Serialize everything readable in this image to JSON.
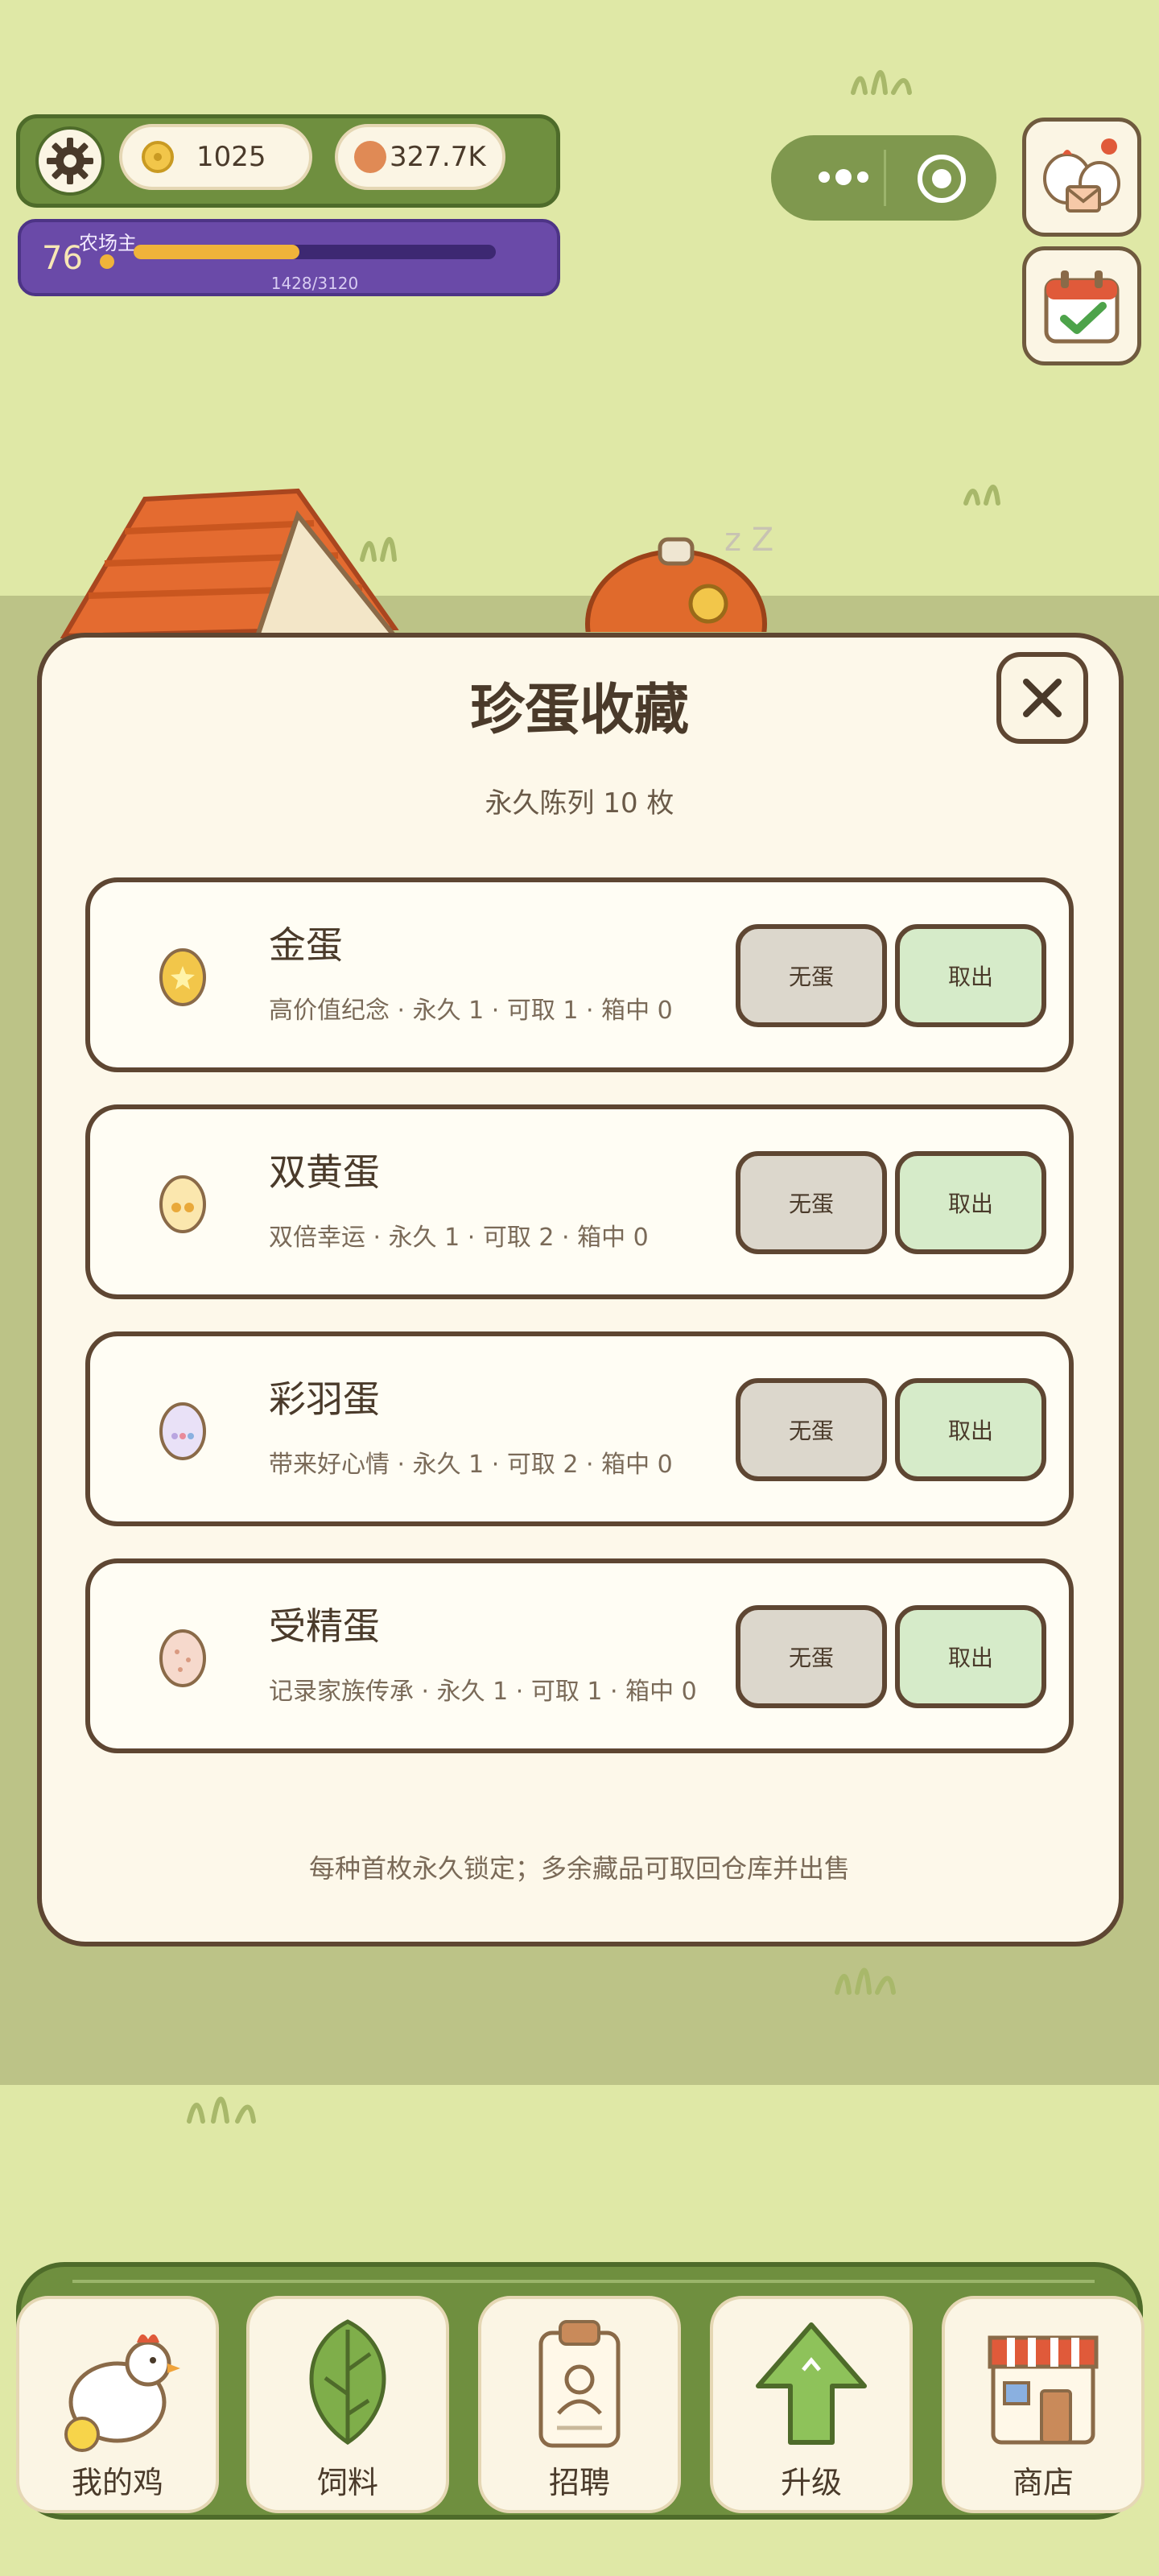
{
  "hud": {
    "coins": "1025",
    "copper": "327.7K",
    "level": "76",
    "level_title": "农场主",
    "xp_text": "1428/3120",
    "xp_progress": 0.458
  },
  "modal": {
    "title": "珍蛋收藏",
    "subtitle": "永久陈列  10 枚",
    "footer": "每种首枚永久锁定；多余藏品可取回仓库并出售",
    "eggs": [
      {
        "name": "金蛋",
        "desc": "高价值纪念 · 永久 1 · 可取 1 · 箱中 0",
        "btn_empty": "无蛋",
        "btn_take": "取出",
        "egg_color": "#f2c64a",
        "accent": "#fff3a8"
      },
      {
        "name": "双黄蛋",
        "desc": "双倍幸运 · 永久 1 · 可取 2 · 箱中 0",
        "btn_empty": "无蛋",
        "btn_take": "取出",
        "egg_color": "#fbe7ae",
        "accent": "#e9a93a"
      },
      {
        "name": "彩羽蛋",
        "desc": "带来好心情 · 永久 1 · 可取 2 · 箱中 0",
        "btn_empty": "无蛋",
        "btn_take": "取出",
        "egg_color": "#e9e1f7",
        "accent": "#b9a5e0"
      },
      {
        "name": "受精蛋",
        "desc": "记录家族传承 · 永久 1 · 可取 1 · 箱中 0",
        "btn_empty": "无蛋",
        "btn_take": "取出",
        "egg_color": "#f6d9cc",
        "accent": "#d99a80"
      }
    ]
  },
  "nav": [
    {
      "label": "我的鸡",
      "icon": "chicken-icon"
    },
    {
      "label": "饲料",
      "icon": "leaf-icon"
    },
    {
      "label": "招聘",
      "icon": "badge-icon"
    },
    {
      "label": "升级",
      "icon": "up-arrow-icon"
    },
    {
      "label": "商店",
      "icon": "shop-icon"
    }
  ]
}
